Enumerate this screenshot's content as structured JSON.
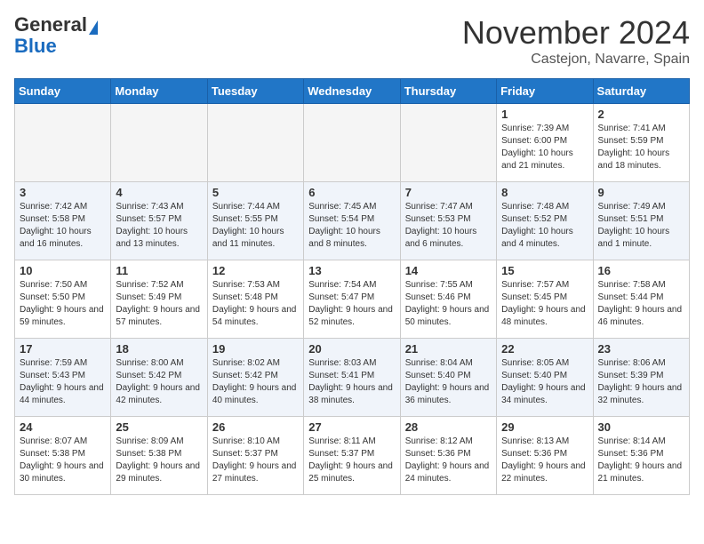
{
  "header": {
    "logo_general": "General",
    "logo_blue": "Blue",
    "month": "November 2024",
    "location": "Castejon, Navarre, Spain"
  },
  "days_of_week": [
    "Sunday",
    "Monday",
    "Tuesday",
    "Wednesday",
    "Thursday",
    "Friday",
    "Saturday"
  ],
  "weeks": [
    {
      "row_class": "row-odd",
      "days": [
        {
          "date": "",
          "empty": true
        },
        {
          "date": "",
          "empty": true
        },
        {
          "date": "",
          "empty": true
        },
        {
          "date": "",
          "empty": true
        },
        {
          "date": "",
          "empty": true
        },
        {
          "date": "1",
          "sunrise": "Sunrise: 7:39 AM",
          "sunset": "Sunset: 6:00 PM",
          "daylight": "Daylight: 10 hours and 21 minutes."
        },
        {
          "date": "2",
          "sunrise": "Sunrise: 7:41 AM",
          "sunset": "Sunset: 5:59 PM",
          "daylight": "Daylight: 10 hours and 18 minutes."
        }
      ]
    },
    {
      "row_class": "row-even",
      "days": [
        {
          "date": "3",
          "sunrise": "Sunrise: 7:42 AM",
          "sunset": "Sunset: 5:58 PM",
          "daylight": "Daylight: 10 hours and 16 minutes."
        },
        {
          "date": "4",
          "sunrise": "Sunrise: 7:43 AM",
          "sunset": "Sunset: 5:57 PM",
          "daylight": "Daylight: 10 hours and 13 minutes."
        },
        {
          "date": "5",
          "sunrise": "Sunrise: 7:44 AM",
          "sunset": "Sunset: 5:55 PM",
          "daylight": "Daylight: 10 hours and 11 minutes."
        },
        {
          "date": "6",
          "sunrise": "Sunrise: 7:45 AM",
          "sunset": "Sunset: 5:54 PM",
          "daylight": "Daylight: 10 hours and 8 minutes."
        },
        {
          "date": "7",
          "sunrise": "Sunrise: 7:47 AM",
          "sunset": "Sunset: 5:53 PM",
          "daylight": "Daylight: 10 hours and 6 minutes."
        },
        {
          "date": "8",
          "sunrise": "Sunrise: 7:48 AM",
          "sunset": "Sunset: 5:52 PM",
          "daylight": "Daylight: 10 hours and 4 minutes."
        },
        {
          "date": "9",
          "sunrise": "Sunrise: 7:49 AM",
          "sunset": "Sunset: 5:51 PM",
          "daylight": "Daylight: 10 hours and 1 minute."
        }
      ]
    },
    {
      "row_class": "row-odd",
      "days": [
        {
          "date": "10",
          "sunrise": "Sunrise: 7:50 AM",
          "sunset": "Sunset: 5:50 PM",
          "daylight": "Daylight: 9 hours and 59 minutes."
        },
        {
          "date": "11",
          "sunrise": "Sunrise: 7:52 AM",
          "sunset": "Sunset: 5:49 PM",
          "daylight": "Daylight: 9 hours and 57 minutes."
        },
        {
          "date": "12",
          "sunrise": "Sunrise: 7:53 AM",
          "sunset": "Sunset: 5:48 PM",
          "daylight": "Daylight: 9 hours and 54 minutes."
        },
        {
          "date": "13",
          "sunrise": "Sunrise: 7:54 AM",
          "sunset": "Sunset: 5:47 PM",
          "daylight": "Daylight: 9 hours and 52 minutes."
        },
        {
          "date": "14",
          "sunrise": "Sunrise: 7:55 AM",
          "sunset": "Sunset: 5:46 PM",
          "daylight": "Daylight: 9 hours and 50 minutes."
        },
        {
          "date": "15",
          "sunrise": "Sunrise: 7:57 AM",
          "sunset": "Sunset: 5:45 PM",
          "daylight": "Daylight: 9 hours and 48 minutes."
        },
        {
          "date": "16",
          "sunrise": "Sunrise: 7:58 AM",
          "sunset": "Sunset: 5:44 PM",
          "daylight": "Daylight: 9 hours and 46 minutes."
        }
      ]
    },
    {
      "row_class": "row-even",
      "days": [
        {
          "date": "17",
          "sunrise": "Sunrise: 7:59 AM",
          "sunset": "Sunset: 5:43 PM",
          "daylight": "Daylight: 9 hours and 44 minutes."
        },
        {
          "date": "18",
          "sunrise": "Sunrise: 8:00 AM",
          "sunset": "Sunset: 5:42 PM",
          "daylight": "Daylight: 9 hours and 42 minutes."
        },
        {
          "date": "19",
          "sunrise": "Sunrise: 8:02 AM",
          "sunset": "Sunset: 5:42 PM",
          "daylight": "Daylight: 9 hours and 40 minutes."
        },
        {
          "date": "20",
          "sunrise": "Sunrise: 8:03 AM",
          "sunset": "Sunset: 5:41 PM",
          "daylight": "Daylight: 9 hours and 38 minutes."
        },
        {
          "date": "21",
          "sunrise": "Sunrise: 8:04 AM",
          "sunset": "Sunset: 5:40 PM",
          "daylight": "Daylight: 9 hours and 36 minutes."
        },
        {
          "date": "22",
          "sunrise": "Sunrise: 8:05 AM",
          "sunset": "Sunset: 5:40 PM",
          "daylight": "Daylight: 9 hours and 34 minutes."
        },
        {
          "date": "23",
          "sunrise": "Sunrise: 8:06 AM",
          "sunset": "Sunset: 5:39 PM",
          "daylight": "Daylight: 9 hours and 32 minutes."
        }
      ]
    },
    {
      "row_class": "row-odd",
      "days": [
        {
          "date": "24",
          "sunrise": "Sunrise: 8:07 AM",
          "sunset": "Sunset: 5:38 PM",
          "daylight": "Daylight: 9 hours and 30 minutes."
        },
        {
          "date": "25",
          "sunrise": "Sunrise: 8:09 AM",
          "sunset": "Sunset: 5:38 PM",
          "daylight": "Daylight: 9 hours and 29 minutes."
        },
        {
          "date": "26",
          "sunrise": "Sunrise: 8:10 AM",
          "sunset": "Sunset: 5:37 PM",
          "daylight": "Daylight: 9 hours and 27 minutes."
        },
        {
          "date": "27",
          "sunrise": "Sunrise: 8:11 AM",
          "sunset": "Sunset: 5:37 PM",
          "daylight": "Daylight: 9 hours and 25 minutes."
        },
        {
          "date": "28",
          "sunrise": "Sunrise: 8:12 AM",
          "sunset": "Sunset: 5:36 PM",
          "daylight": "Daylight: 9 hours and 24 minutes."
        },
        {
          "date": "29",
          "sunrise": "Sunrise: 8:13 AM",
          "sunset": "Sunset: 5:36 PM",
          "daylight": "Daylight: 9 hours and 22 minutes."
        },
        {
          "date": "30",
          "sunrise": "Sunrise: 8:14 AM",
          "sunset": "Sunset: 5:36 PM",
          "daylight": "Daylight: 9 hours and 21 minutes."
        }
      ]
    }
  ]
}
